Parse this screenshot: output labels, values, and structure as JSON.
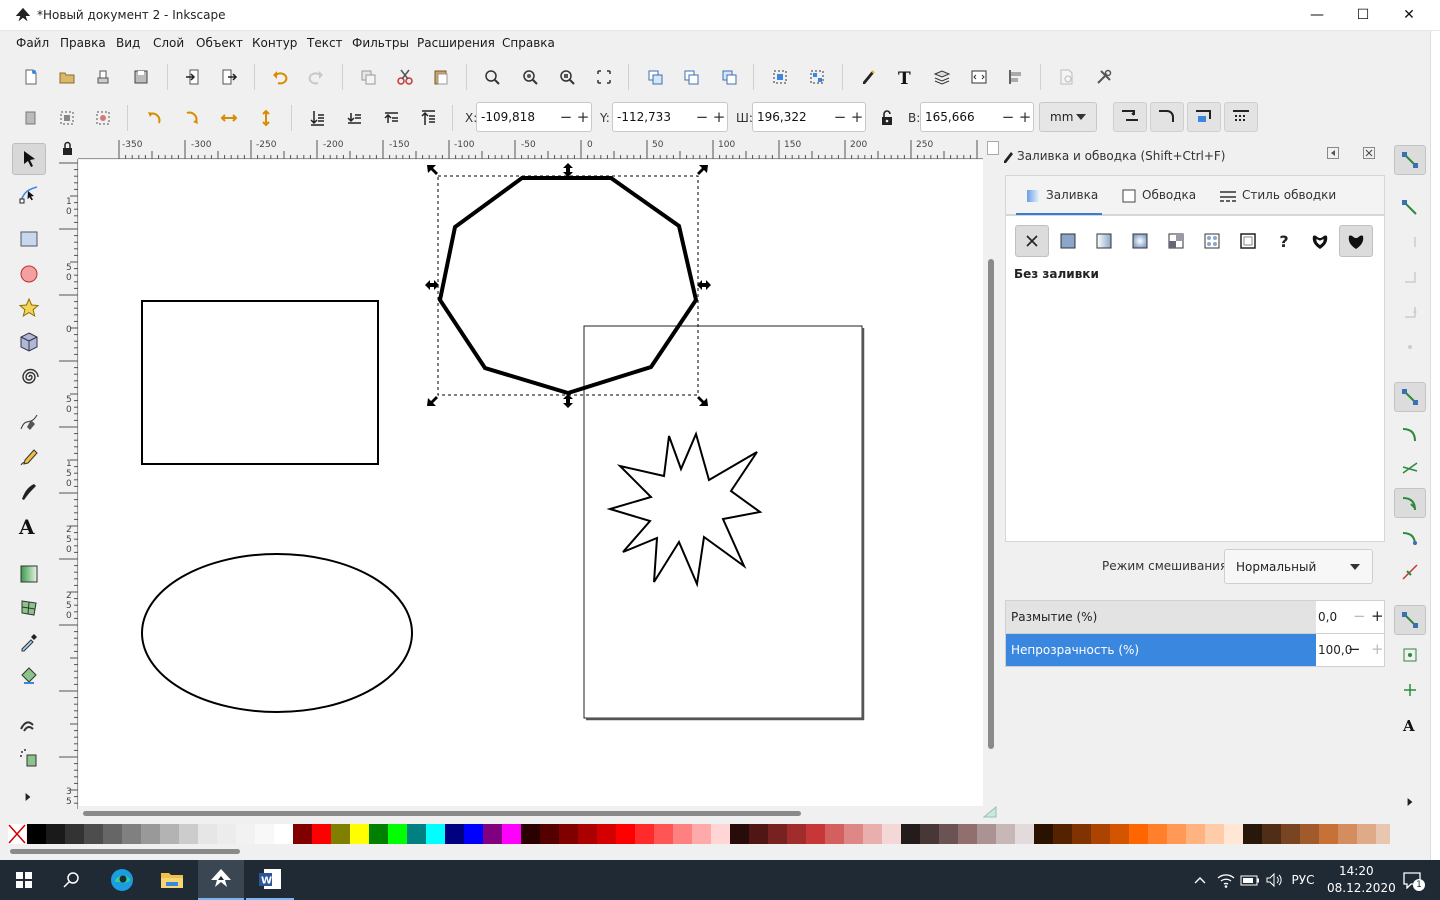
{
  "window": {
    "title": "*Новый документ 2 - Inkscape",
    "buttons": {
      "minimize": "—",
      "maximize": "☐",
      "close": "✕"
    }
  },
  "menu": [
    "Файл",
    "Правка",
    "Вид",
    "Слой",
    "Объект",
    "Контур",
    "Текст",
    "Фильтры",
    "Расширения",
    "Справка"
  ],
  "controls": {
    "x_label": "X:",
    "x_value": "-109,818",
    "y_label": "Y:",
    "y_value": "-112,733",
    "w_label": "Ш:",
    "w_value": "196,322",
    "h_label": "В:",
    "h_value": "165,666",
    "unit": "mm",
    "minus": "−",
    "plus": "+"
  },
  "ruler": {
    "h_labels": [
      "-350",
      "-300",
      "-250",
      "-200",
      "-150",
      "-100",
      "-50",
      "0",
      "50",
      "100",
      "150",
      "200",
      "250"
    ],
    "v_labels": [
      "1",
      "0",
      "5",
      "0",
      "0",
      "5",
      "0",
      "1",
      "5",
      "0",
      "2",
      "5",
      "0",
      "2",
      "5",
      "0",
      "3",
      "5"
    ]
  },
  "dock": {
    "title": "Заливка и обводка (Shift+Ctrl+F)",
    "tabs": {
      "fill": "Заливка",
      "stroke": "Обводка",
      "stroke_style": "Стиль обводки"
    },
    "fill_status": "Без заливки",
    "blend_label": "Режим смешивания:",
    "blend_value": "Нормальный",
    "blur_label": "Размытие (%)",
    "blur_value": "0,0",
    "opacity_label": "Непрозрачность (%)",
    "opacity_value": "100,0",
    "opacity_fraction": 1.0,
    "unknown_paint": "?"
  },
  "taskbar": {
    "lang": "РУС",
    "time": "14:20",
    "date": "08.12.2020",
    "notif_count": "1"
  },
  "colors": {
    "accent": "#3a7bd5",
    "taskbar": "#1f2a35",
    "selection_highlight": "#3a87e0"
  },
  "palette": [
    "#000000",
    "#1a1a1a",
    "#333333",
    "#4d4d4d",
    "#666666",
    "#808080",
    "#999999",
    "#b3b3b3",
    "#cccccc",
    "#e6e6e6",
    "#ececec",
    "#f2f2f2",
    "#f8f8f8",
    "#ffffff",
    "#800000",
    "#ff0000",
    "#808000",
    "#ffff00",
    "#008000",
    "#00ff00",
    "#008080",
    "#00ffff",
    "#000080",
    "#0000ff",
    "#800080",
    "#ff00ff",
    "#2b0000",
    "#550000",
    "#800000",
    "#aa0000",
    "#d40000",
    "#ff0000",
    "#ff2a2a",
    "#ff5555",
    "#ff8080",
    "#ffaaaa",
    "#ffd5d5",
    "#280b0b",
    "#501616",
    "#782121",
    "#a02c2c",
    "#c83737",
    "#d35f5f",
    "#de8787",
    "#e9afaf",
    "#f4d7d7",
    "#241c1c",
    "#483737",
    "#6c5353",
    "#916f6f",
    "#ac9393",
    "#c8b7b7",
    "#e3dbdb",
    "#2b1100",
    "#552200",
    "#803300",
    "#aa4400",
    "#d45500",
    "#ff6600",
    "#ff7f2a",
    "#ff9955",
    "#ffb380",
    "#ffccaa",
    "#ffe6d5",
    "#28170b",
    "#502d16",
    "#784421",
    "#a05a2c",
    "#c87137",
    "#d38d5f",
    "#deaa87",
    "#e9c6af",
    "#f4e3d7"
  ]
}
